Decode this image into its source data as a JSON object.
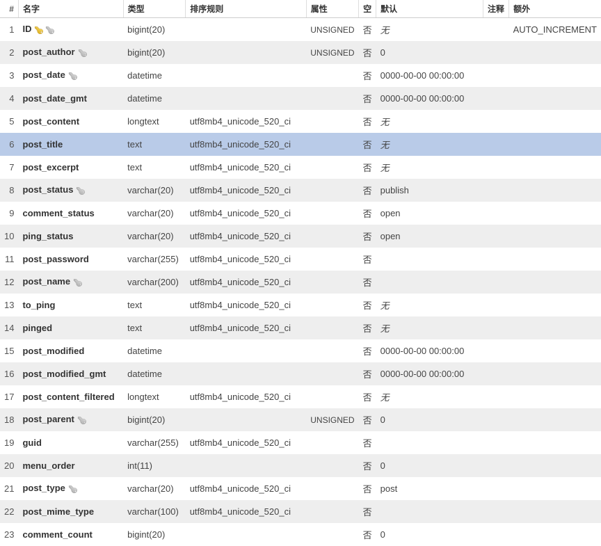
{
  "headers": {
    "num": "#",
    "name": "名字",
    "type": "类型",
    "collation": "排序规则",
    "attributes": "属性",
    "nullable": "空",
    "default": "默认",
    "comments": "注释",
    "extra": "额外"
  },
  "none_label": "无",
  "rows": [
    {
      "num": 1,
      "name": "ID",
      "primary": true,
      "index": true,
      "type": "bigint(20)",
      "collation": "",
      "attributes": "UNSIGNED",
      "nullable": "否",
      "default": "无",
      "default_is_none": true,
      "extra": "AUTO_INCREMENT",
      "selected": false
    },
    {
      "num": 2,
      "name": "post_author",
      "primary": false,
      "index": true,
      "type": "bigint(20)",
      "collation": "",
      "attributes": "UNSIGNED",
      "nullable": "否",
      "default": "0",
      "default_is_none": false,
      "extra": "",
      "selected": false
    },
    {
      "num": 3,
      "name": "post_date",
      "primary": false,
      "index": true,
      "type": "datetime",
      "collation": "",
      "attributes": "",
      "nullable": "否",
      "default": "0000-00-00 00:00:00",
      "default_is_none": false,
      "extra": "",
      "selected": false
    },
    {
      "num": 4,
      "name": "post_date_gmt",
      "primary": false,
      "index": false,
      "type": "datetime",
      "collation": "",
      "attributes": "",
      "nullable": "否",
      "default": "0000-00-00 00:00:00",
      "default_is_none": false,
      "extra": "",
      "selected": false
    },
    {
      "num": 5,
      "name": "post_content",
      "primary": false,
      "index": false,
      "type": "longtext",
      "collation": "utf8mb4_unicode_520_ci",
      "attributes": "",
      "nullable": "否",
      "default": "无",
      "default_is_none": true,
      "extra": "",
      "selected": false
    },
    {
      "num": 6,
      "name": "post_title",
      "primary": false,
      "index": false,
      "type": "text",
      "collation": "utf8mb4_unicode_520_ci",
      "attributes": "",
      "nullable": "否",
      "default": "无",
      "default_is_none": true,
      "extra": "",
      "selected": true
    },
    {
      "num": 7,
      "name": "post_excerpt",
      "primary": false,
      "index": false,
      "type": "text",
      "collation": "utf8mb4_unicode_520_ci",
      "attributes": "",
      "nullable": "否",
      "default": "无",
      "default_is_none": true,
      "extra": "",
      "selected": false
    },
    {
      "num": 8,
      "name": "post_status",
      "primary": false,
      "index": true,
      "type": "varchar(20)",
      "collation": "utf8mb4_unicode_520_ci",
      "attributes": "",
      "nullable": "否",
      "default": "publish",
      "default_is_none": false,
      "extra": "",
      "selected": false
    },
    {
      "num": 9,
      "name": "comment_status",
      "primary": false,
      "index": false,
      "type": "varchar(20)",
      "collation": "utf8mb4_unicode_520_ci",
      "attributes": "",
      "nullable": "否",
      "default": "open",
      "default_is_none": false,
      "extra": "",
      "selected": false
    },
    {
      "num": 10,
      "name": "ping_status",
      "primary": false,
      "index": false,
      "type": "varchar(20)",
      "collation": "utf8mb4_unicode_520_ci",
      "attributes": "",
      "nullable": "否",
      "default": "open",
      "default_is_none": false,
      "extra": "",
      "selected": false
    },
    {
      "num": 11,
      "name": "post_password",
      "primary": false,
      "index": false,
      "type": "varchar(255)",
      "collation": "utf8mb4_unicode_520_ci",
      "attributes": "",
      "nullable": "否",
      "default": "",
      "default_is_none": false,
      "extra": "",
      "selected": false
    },
    {
      "num": 12,
      "name": "post_name",
      "primary": false,
      "index": true,
      "type": "varchar(200)",
      "collation": "utf8mb4_unicode_520_ci",
      "attributes": "",
      "nullable": "否",
      "default": "",
      "default_is_none": false,
      "extra": "",
      "selected": false
    },
    {
      "num": 13,
      "name": "to_ping",
      "primary": false,
      "index": false,
      "type": "text",
      "collation": "utf8mb4_unicode_520_ci",
      "attributes": "",
      "nullable": "否",
      "default": "无",
      "default_is_none": true,
      "extra": "",
      "selected": false
    },
    {
      "num": 14,
      "name": "pinged",
      "primary": false,
      "index": false,
      "type": "text",
      "collation": "utf8mb4_unicode_520_ci",
      "attributes": "",
      "nullable": "否",
      "default": "无",
      "default_is_none": true,
      "extra": "",
      "selected": false
    },
    {
      "num": 15,
      "name": "post_modified",
      "primary": false,
      "index": false,
      "type": "datetime",
      "collation": "",
      "attributes": "",
      "nullable": "否",
      "default": "0000-00-00 00:00:00",
      "default_is_none": false,
      "extra": "",
      "selected": false
    },
    {
      "num": 16,
      "name": "post_modified_gmt",
      "primary": false,
      "index": false,
      "type": "datetime",
      "collation": "",
      "attributes": "",
      "nullable": "否",
      "default": "0000-00-00 00:00:00",
      "default_is_none": false,
      "extra": "",
      "selected": false
    },
    {
      "num": 17,
      "name": "post_content_filtered",
      "primary": false,
      "index": false,
      "type": "longtext",
      "collation": "utf8mb4_unicode_520_ci",
      "attributes": "",
      "nullable": "否",
      "default": "无",
      "default_is_none": true,
      "extra": "",
      "selected": false
    },
    {
      "num": 18,
      "name": "post_parent",
      "primary": false,
      "index": true,
      "type": "bigint(20)",
      "collation": "",
      "attributes": "UNSIGNED",
      "nullable": "否",
      "default": "0",
      "default_is_none": false,
      "extra": "",
      "selected": false
    },
    {
      "num": 19,
      "name": "guid",
      "primary": false,
      "index": false,
      "type": "varchar(255)",
      "collation": "utf8mb4_unicode_520_ci",
      "attributes": "",
      "nullable": "否",
      "default": "",
      "default_is_none": false,
      "extra": "",
      "selected": false
    },
    {
      "num": 20,
      "name": "menu_order",
      "primary": false,
      "index": false,
      "type": "int(11)",
      "collation": "",
      "attributes": "",
      "nullable": "否",
      "default": "0",
      "default_is_none": false,
      "extra": "",
      "selected": false
    },
    {
      "num": 21,
      "name": "post_type",
      "primary": false,
      "index": true,
      "type": "varchar(20)",
      "collation": "utf8mb4_unicode_520_ci",
      "attributes": "",
      "nullable": "否",
      "default": "post",
      "default_is_none": false,
      "extra": "",
      "selected": false
    },
    {
      "num": 22,
      "name": "post_mime_type",
      "primary": false,
      "index": false,
      "type": "varchar(100)",
      "collation": "utf8mb4_unicode_520_ci",
      "attributes": "",
      "nullable": "否",
      "default": "",
      "default_is_none": false,
      "extra": "",
      "selected": false
    },
    {
      "num": 23,
      "name": "comment_count",
      "primary": false,
      "index": false,
      "type": "bigint(20)",
      "collation": "",
      "attributes": "",
      "nullable": "否",
      "default": "0",
      "default_is_none": false,
      "extra": "",
      "selected": false
    }
  ]
}
